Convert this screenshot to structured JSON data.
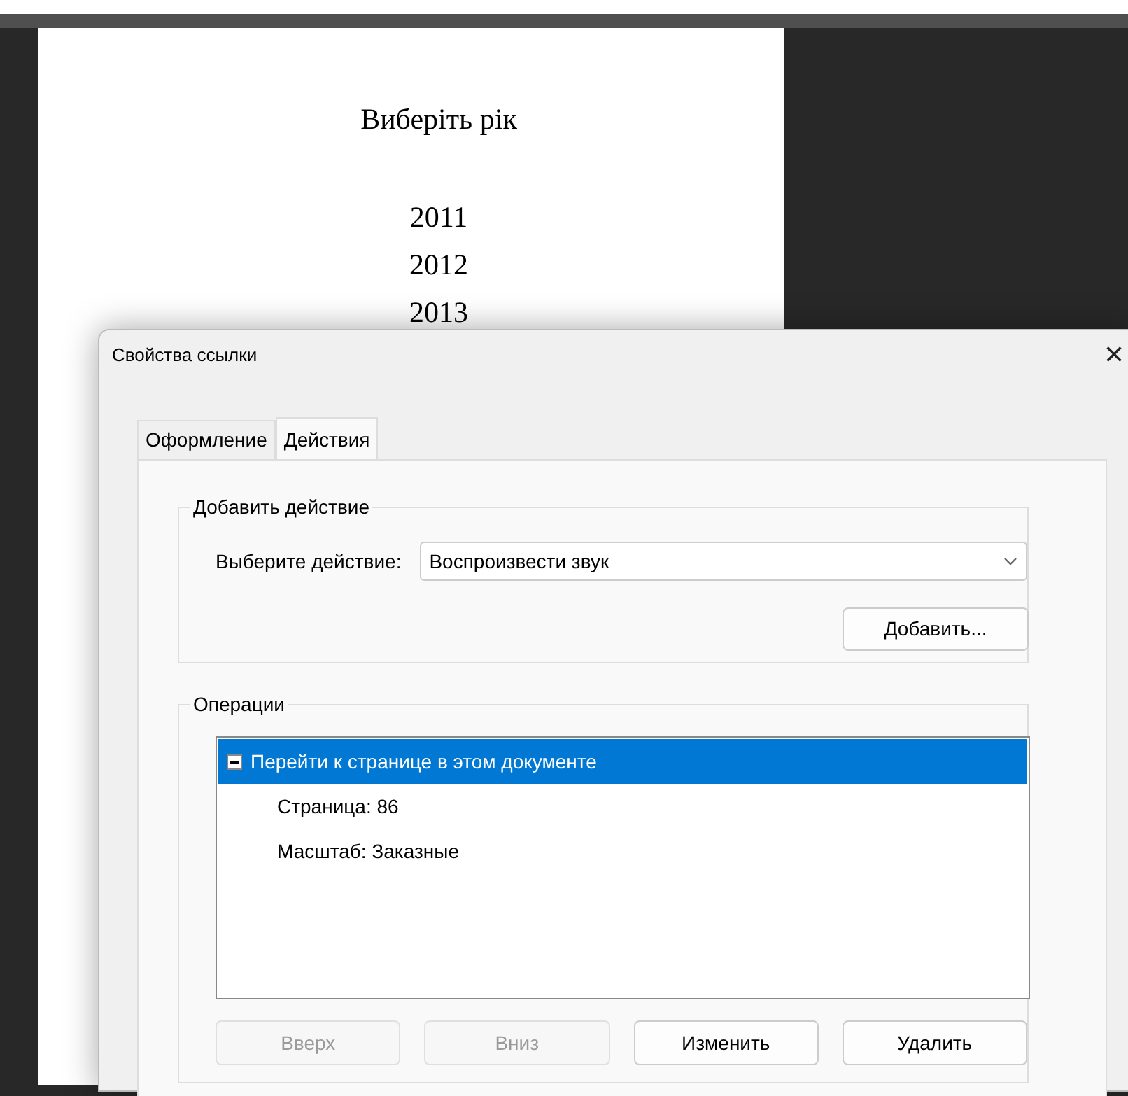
{
  "document": {
    "heading": "Виберіть рік",
    "years": [
      "2011",
      "2012",
      "2013"
    ]
  },
  "dialog": {
    "title": "Свойства ссылки",
    "close": "×",
    "tabs": [
      {
        "label": "Оформление",
        "selected": false
      },
      {
        "label": "Действия",
        "selected": true
      }
    ],
    "add_action": {
      "legend": "Добавить действие",
      "label": "Выберите действие:",
      "value": "Воспроизвести звук",
      "button": "Добавить..."
    },
    "operations": {
      "legend": "Операции",
      "items": [
        {
          "label": "Перейти к странице в этом документе",
          "expanded": true,
          "selected": true,
          "children": [
            {
              "label": "Страница: 86"
            },
            {
              "label": "Масштаб: Заказные"
            }
          ]
        }
      ],
      "buttons": [
        {
          "label": "Вверх",
          "disabled": true
        },
        {
          "label": "Вниз",
          "disabled": true
        },
        {
          "label": "Изменить",
          "disabled": false
        },
        {
          "label": "Удалить",
          "disabled": false
        }
      ]
    }
  }
}
